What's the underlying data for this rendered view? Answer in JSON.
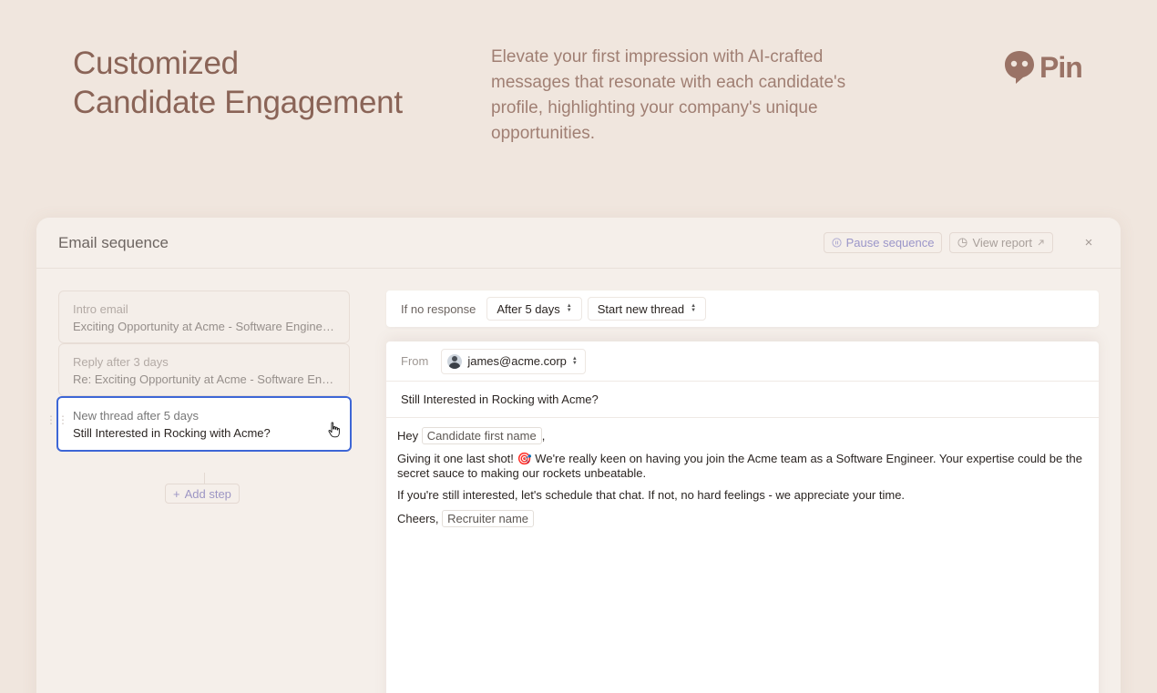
{
  "hero": {
    "title_line1": "Customized",
    "title_line2": "Candidate Engagement",
    "description": "Elevate your first impression with AI-crafted messages that resonate with each candidate's profile, highlighting your company's unique opportunities.",
    "brand_name": "Pin"
  },
  "panel": {
    "title": "Email sequence",
    "pause_label": "Pause sequence",
    "report_label": "View report",
    "close_glyph": "×"
  },
  "steps": [
    {
      "title": "Intro email",
      "subject": "Exciting Opportunity at Acme - Software Engineer Position"
    },
    {
      "title": "Reply after 3 days",
      "subject": "Re: Exciting Opportunity at Acme - Software Engineer Position"
    },
    {
      "title": "New thread after 5 days",
      "subject": "Still Interested in Rocking with Acme?"
    }
  ],
  "add_step_label": "Add step",
  "condition": {
    "label": "If no response",
    "delay_value": "After 5 days",
    "thread_value": "Start new thread"
  },
  "email": {
    "from_label": "From",
    "sender": "james@acme.corp",
    "subject": "Still Interested in Rocking with Acme?",
    "greeting": "Hey",
    "greeting_var": "Candidate first name",
    "greeting_end": ",",
    "para1": "Giving it one last shot! 🎯 We're really keen on having you join the Acme team as a Software Engineer. Your expertise could be the secret sauce to making our rockets unbeatable.",
    "para2": "If you're still interested, let's schedule that chat. If not, no hard feelings - we appreciate your time.",
    "signoff": "Cheers,",
    "signoff_var": "Recruiter name"
  },
  "colors": {
    "background": "#f0e6de",
    "hero_text": "#8a6457",
    "accent_blue": "#3d66d6",
    "accent_purple": "#9b96c9"
  }
}
